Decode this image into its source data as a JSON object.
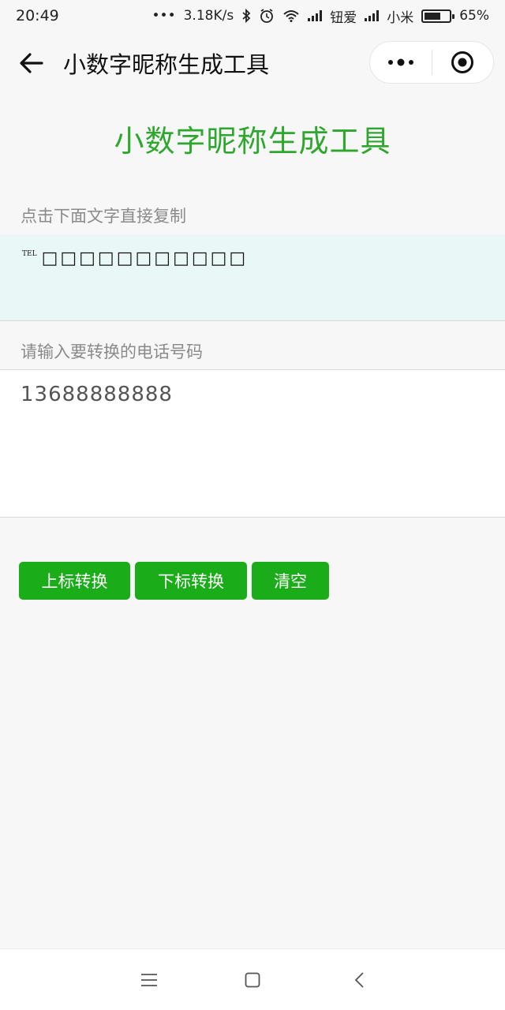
{
  "status_bar": {
    "time": "20:49",
    "dots": "•••",
    "net_speed": "3.18K/s",
    "carrier1": "钮爱",
    "carrier2": "小米",
    "battery": "65%",
    "battery_level": 0.65
  },
  "nav": {
    "title": "小数字昵称生成工具"
  },
  "main": {
    "heading": "小数字昵称生成工具",
    "copy_label": "点击下面文字直接复制",
    "result_prefix": "TEL",
    "result_text": "□□□□□□□□□□□",
    "input_label": "请输入要转换的电话号码",
    "input_value": "13688888888"
  },
  "buttons": {
    "superscript": "上标转换",
    "subscript": "下标转换",
    "clear": "清空"
  },
  "colors": {
    "accent": "#2ea72e",
    "button": "#1aad19",
    "result_bg": "#e9f7f6"
  }
}
